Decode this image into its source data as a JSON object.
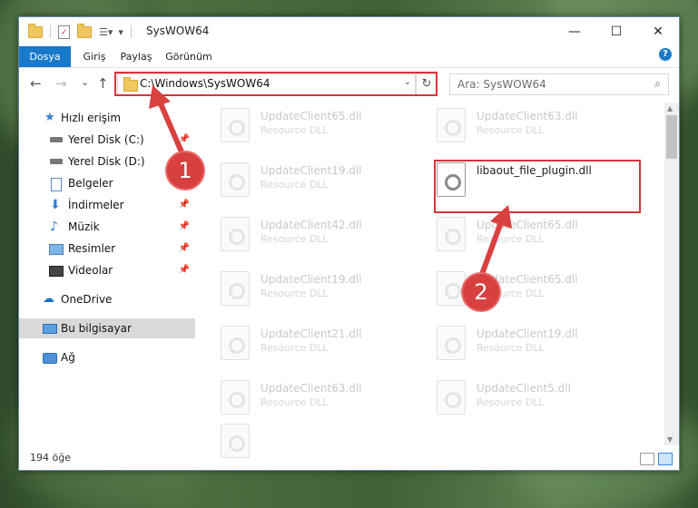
{
  "window": {
    "title": "SysWOW64",
    "minimize_glyph": "—",
    "maximize_glyph": "☐",
    "close_glyph": "✕"
  },
  "ribbon": {
    "tabs": [
      {
        "label": "Dosya"
      },
      {
        "label": "Giriş"
      },
      {
        "label": "Paylaş"
      },
      {
        "label": "Görünüm"
      }
    ],
    "help_glyph": "?"
  },
  "nav": {
    "back_glyph": "←",
    "forward_glyph": "→",
    "recent_glyph": "⌄",
    "up_glyph": "↑",
    "address": "C:\\Windows\\SysWOW64",
    "address_dropdown_glyph": "⌄",
    "refresh_glyph": "↻",
    "search_placeholder": "Ara: SysWOW64",
    "search_glyph": "⌕"
  },
  "sidebar": {
    "items": [
      {
        "label": "Hızlı erişim",
        "icon": "star-icon"
      },
      {
        "label": "Yerel Disk (C:)",
        "icon": "drive-icon",
        "pinned": true
      },
      {
        "label": "Yerel Disk (D:)",
        "icon": "drive-icon"
      },
      {
        "label": "Belgeler",
        "icon": "documents-icon",
        "pinned": true
      },
      {
        "label": "İndirmeler",
        "icon": "download-icon",
        "pinned": true
      },
      {
        "label": "Müzik",
        "icon": "music-icon",
        "pinned": true
      },
      {
        "label": "Resimler",
        "icon": "pictures-icon",
        "pinned": true
      },
      {
        "label": "Videolar",
        "icon": "videos-icon",
        "pinned": true
      },
      {
        "label": "OneDrive",
        "icon": "cloud-icon"
      },
      {
        "label": "Bu bilgisayar",
        "icon": "computer-icon",
        "selected": true
      },
      {
        "label": "Ağ",
        "icon": "network-icon"
      }
    ],
    "pin_glyph": "📌"
  },
  "files": {
    "left_column": [
      {
        "name": "UpdateClient65.dll",
        "type": "Resource DLL"
      },
      {
        "name": "UpdateClient19.dll",
        "type": "Resource DLL"
      },
      {
        "name": "UpdateClient42.dll",
        "type": "Resource DLL"
      },
      {
        "name": "UpdateClient19.dll",
        "type": "Resource DLL"
      },
      {
        "name": "UpdateClient21.dll",
        "type": "Resource DLL"
      },
      {
        "name": "UpdateClient63.dll",
        "type": "Resource DLL"
      },
      {
        "name": "",
        "type": ""
      }
    ],
    "right_column": [
      {
        "name": "UpdateClient63.dll",
        "type": "Resource DLL"
      },
      {
        "name": "libaout_file_plugin.dll",
        "type": ""
      },
      {
        "name": "UpdateClient65.dll",
        "type": "Resource DLL"
      },
      {
        "name": "UpdateClient65.dll",
        "type": "Resource DLL"
      },
      {
        "name": "UpdateClient19.dll",
        "type": "Resource DLL"
      },
      {
        "name": "UpdateClient5.dll",
        "type": "Resource DLL"
      }
    ]
  },
  "status": {
    "item_count": "194 öğe"
  },
  "annotations": {
    "badge1": "1",
    "badge2": "2",
    "accent_color": "#d9343a"
  }
}
